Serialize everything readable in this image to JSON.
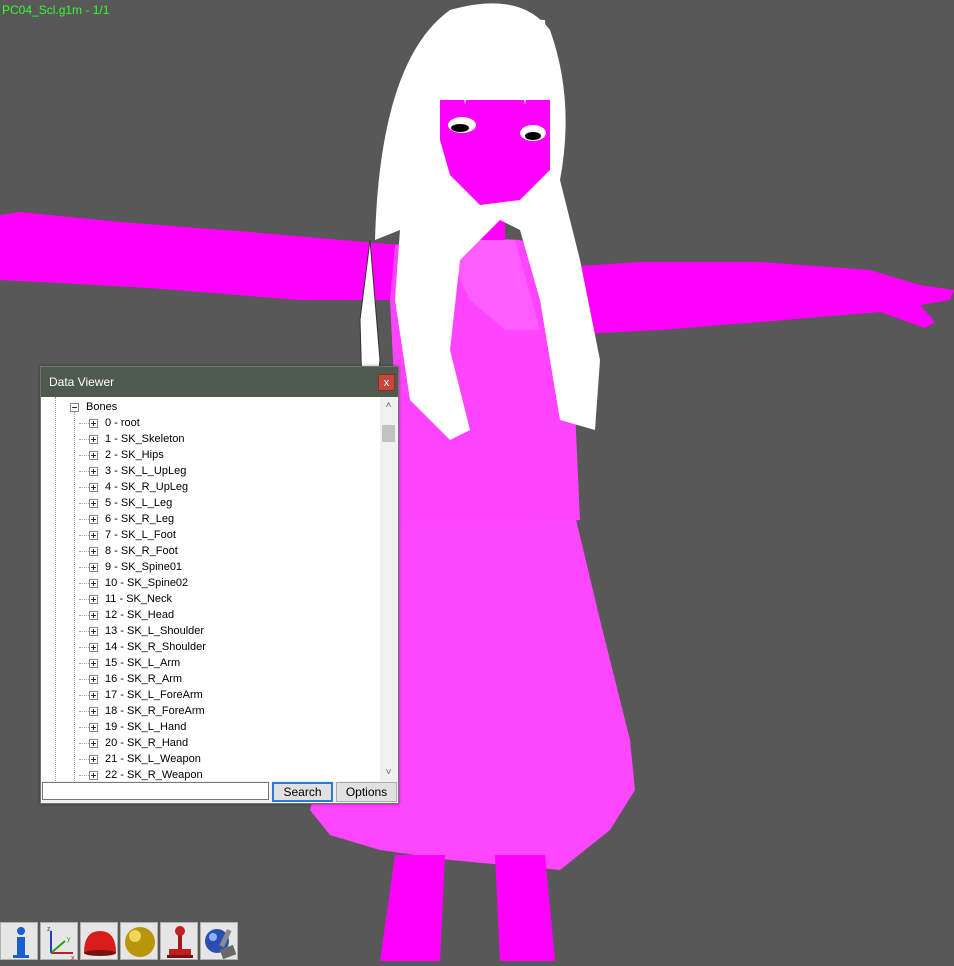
{
  "viewport": {
    "file_label": "PC04_Scl.g1m - 1/1",
    "background": "#585858",
    "model_colors": {
      "body": "#ff00ff",
      "hair": "#ffffff",
      "clothing": "#ff55ff"
    }
  },
  "data_viewer": {
    "title": "Data Viewer",
    "close_label": "x",
    "tree": {
      "root_label": "Bones",
      "items": [
        "0 - root",
        "1 - SK_Skeleton",
        "2 - SK_Hips",
        "3 - SK_L_UpLeg",
        "4 - SK_R_UpLeg",
        "5 - SK_L_Leg",
        "6 - SK_R_Leg",
        "7 - SK_L_Foot",
        "8 - SK_R_Foot",
        "9 - SK_Spine01",
        "10 - SK_Spine02",
        "11 - SK_Neck",
        "12 - SK_Head",
        "13 - SK_L_Shoulder",
        "14 - SK_R_Shoulder",
        "15 - SK_L_Arm",
        "16 - SK_R_Arm",
        "17 - SK_L_ForeArm",
        "18 - SK_R_ForeArm",
        "19 - SK_L_Hand",
        "20 - SK_R_Hand",
        "21 - SK_L_Weapon",
        "22 - SK_R_Weapon"
      ]
    },
    "search": {
      "value": "",
      "button_label": "Search"
    },
    "options_label": "Options"
  },
  "toolbar": {
    "tools": [
      {
        "icon": "info-icon"
      },
      {
        "icon": "axes-icon"
      },
      {
        "icon": "red-dome-icon"
      },
      {
        "icon": "gold-sphere-icon"
      },
      {
        "icon": "joystick-icon"
      },
      {
        "icon": "globe-tool-icon"
      }
    ]
  }
}
